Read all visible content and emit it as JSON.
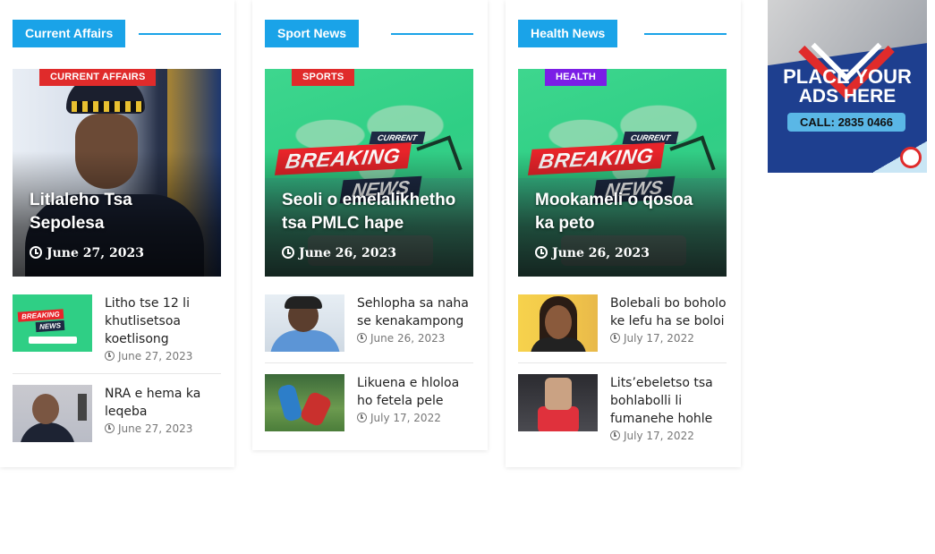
{
  "columns": [
    {
      "title": "Current Affairs",
      "feature": {
        "badge": "CURRENT AFFAIRS",
        "badge_color": "#e02b2b",
        "image": "police-officer-photo",
        "title": "Litlaleho Tsa Sepolesa",
        "date": "June 27, 2023"
      },
      "items": [
        {
          "title": "Litho tse 12 li khutlisetsoa koetlisong",
          "date": "June 27, 2023",
          "image": "breaking-news-thumb"
        },
        {
          "title": "NRA e hema ka leqeba",
          "date": "June 27, 2023",
          "image": "man-speaking-thumb"
        }
      ]
    },
    {
      "title": "Sport News",
      "feature": {
        "badge": "SPORTS",
        "badge_color": "#e02b2b",
        "image": "breaking-news-graphic",
        "title": "Seoli o emelalikhetho tsa PMLC hape",
        "date": "June 26, 2023"
      },
      "items": [
        {
          "title": "Sehlopha sa naha se kenakampong",
          "date": "June 26, 2023",
          "image": "man-cap-thumb"
        },
        {
          "title": "Likuena e hloloa ho fetela pele",
          "date": "July 17, 2022",
          "image": "soccer-thumb"
        }
      ]
    },
    {
      "title": "Health News",
      "feature": {
        "badge": "HEALTH",
        "badge_color": "#7b1ee6",
        "image": "breaking-news-graphic",
        "title": "Mookameli o qosoa ka peto",
        "date": "June 26, 2023"
      },
      "items": [
        {
          "title": "Bolebali bo boholo ke lefu ha se boloi",
          "date": "July 17, 2022",
          "image": "woman-glasses-thumb"
        },
        {
          "title": "Lits’ebeletso tsa bohlabolli li fumanehe hohle",
          "date": "July 17, 2022",
          "image": "gym-thumb"
        }
      ]
    }
  ],
  "graphic_text": {
    "current": "CURRENT",
    "breaking": "BREAKING",
    "news": "NEWS"
  },
  "ad": {
    "line1": "PLACE YOUR",
    "line2": "ADS HERE",
    "call": "CALL: 2835 0466"
  },
  "colors": {
    "accent": "#1aa3e8",
    "badge_red": "#e02b2b",
    "badge_purple": "#7b1ee6",
    "ad_bg": "#1e3f8f"
  }
}
